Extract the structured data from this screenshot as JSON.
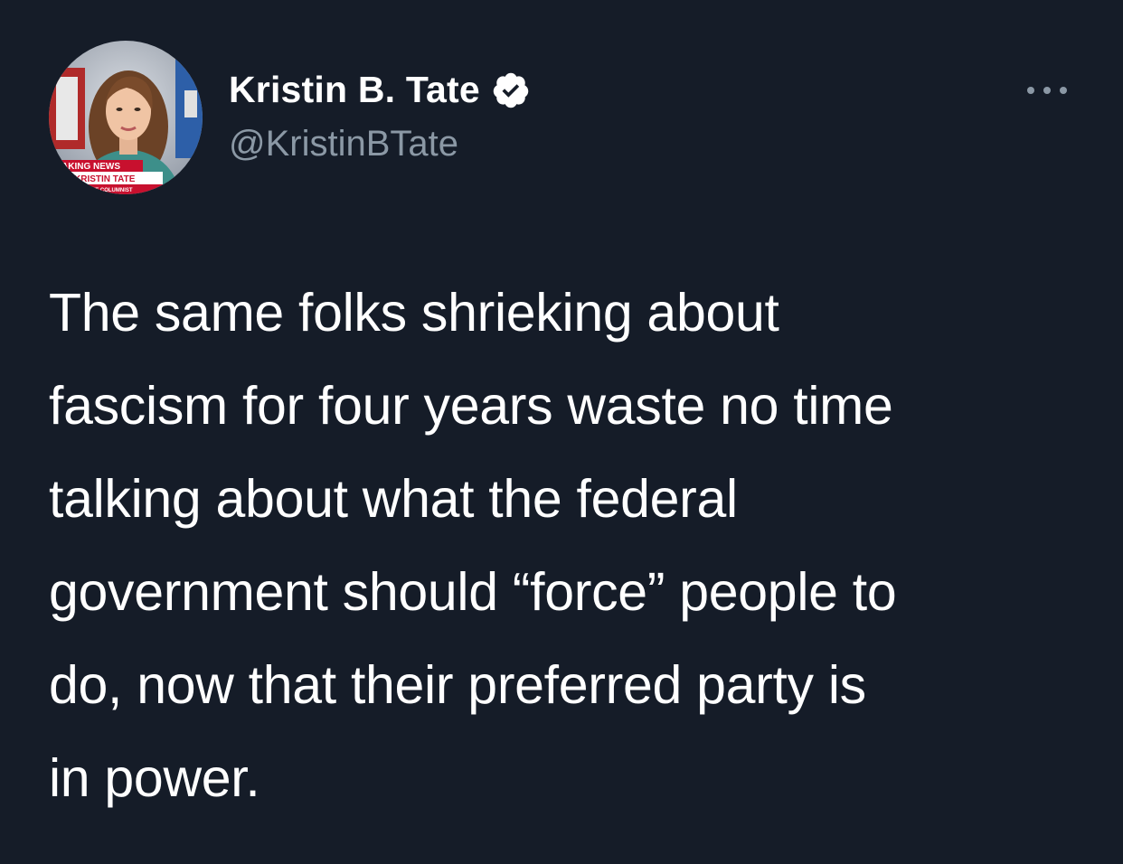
{
  "author": {
    "display_name": "Kristin B. Tate",
    "handle": "@KristinBTate",
    "verified": true,
    "avatar_chyron": {
      "line1": "AKING NEWS",
      "line2": "KRISTIN TATE",
      "line3": "ATIVE COLUMNIST"
    }
  },
  "tweet": {
    "lines": [
      "The same folks shrieking about",
      "fascism for four years waste no time",
      "talking about what the federal",
      "government should “force” people to",
      "do, now that their preferred party is",
      "in power."
    ]
  },
  "icons": {
    "verified": "verified-badge-icon",
    "more": "more-options-icon"
  },
  "colors": {
    "background": "#151c28",
    "text": "#ffffff",
    "secondary_text": "#8b98a5",
    "chyron_red": "#c8102e"
  }
}
